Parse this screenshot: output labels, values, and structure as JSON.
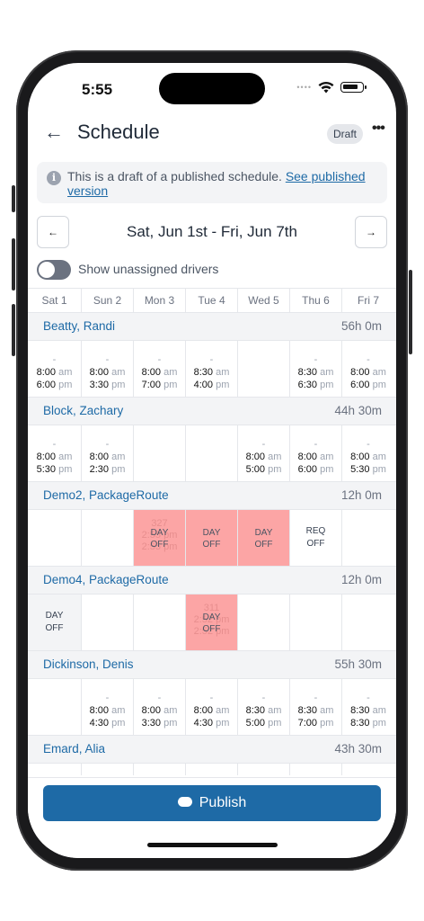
{
  "status": {
    "time": "5:55"
  },
  "header": {
    "title": "Schedule",
    "badge": "Draft",
    "more": "•••"
  },
  "notice": {
    "text": "This is a draft of a published schedule.",
    "link": "See published version"
  },
  "week": {
    "label": "Sat, Jun 1st - Fri, Jun 7th",
    "prev": "←",
    "next": "→"
  },
  "toggle": {
    "label": "Show unassigned drivers"
  },
  "days": [
    "Sat 1",
    "Sun 2",
    "Mon 3",
    "Tue 4",
    "Wed 5",
    "Thu 6",
    "Fri 7"
  ],
  "drivers": [
    {
      "name": "Beatty, Randi",
      "hours": "56h 0m"
    },
    {
      "name": "Block, Zachary",
      "hours": "44h 30m"
    },
    {
      "name": "Demo2, PackageRoute",
      "hours": "12h 0m"
    },
    {
      "name": "Demo4, PackageRoute",
      "hours": "12h 0m"
    },
    {
      "name": "Dickinson, Denis",
      "hours": "55h 30m"
    },
    {
      "name": "Emard, Alia",
      "hours": "43h 30m"
    }
  ],
  "shifts": {
    "r0c0": {
      "dash": "-",
      "start": "8:00",
      "start_ap": "am",
      "end": "6:00",
      "end_ap": "pm"
    },
    "r0c1": {
      "dash": "-",
      "start": "8:00",
      "start_ap": "am",
      "end": "3:30",
      "end_ap": "pm"
    },
    "r0c2": {
      "dash": "-",
      "start": "8:00",
      "start_ap": "am",
      "end": "7:00",
      "end_ap": "pm"
    },
    "r0c3": {
      "dash": "-",
      "start": "8:30",
      "start_ap": "am",
      "end": "4:00",
      "end_ap": "pm"
    },
    "r0c5": {
      "dash": "-",
      "start": "8:30",
      "start_ap": "am",
      "end": "6:30",
      "end_ap": "pm"
    },
    "r0c6": {
      "dash": "-",
      "start": "8:00",
      "start_ap": "am",
      "end": "6:00",
      "end_ap": "pm"
    },
    "r1c0": {
      "dash": "-",
      "start": "8:00",
      "start_ap": "am",
      "end": "5:30",
      "end_ap": "pm"
    },
    "r1c1": {
      "dash": "-",
      "start": "8:00",
      "start_ap": "am",
      "end": "2:30",
      "end_ap": "pm"
    },
    "r1c4": {
      "dash": "-",
      "start": "8:00",
      "start_ap": "am",
      "end": "5:00",
      "end_ap": "pm"
    },
    "r1c5": {
      "dash": "-",
      "start": "8:00",
      "start_ap": "am",
      "end": "6:00",
      "end_ap": "pm"
    },
    "r1c6": {
      "dash": "-",
      "start": "8:00",
      "start_ap": "am",
      "end": "5:30",
      "end_ap": "pm"
    },
    "r4c1": {
      "dash": "-",
      "start": "8:00",
      "start_ap": "am",
      "end": "4:30",
      "end_ap": "pm"
    },
    "r4c2": {
      "dash": "-",
      "start": "8:00",
      "start_ap": "am",
      "end": "3:30",
      "end_ap": "pm"
    },
    "r4c3": {
      "dash": "-",
      "start": "8:00",
      "start_ap": "am",
      "end": "4:30",
      "end_ap": "pm"
    },
    "r4c4": {
      "dash": "-",
      "start": "8:30",
      "start_ap": "am",
      "end": "5:00",
      "end_ap": "pm"
    },
    "r4c5": {
      "dash": "-",
      "start": "8:30",
      "start_ap": "am",
      "end": "7:00",
      "end_ap": "pm"
    },
    "r4c6": {
      "dash": "-",
      "start": "8:30",
      "start_ap": "am",
      "end": "8:30",
      "end_ap": "pm"
    }
  },
  "dayoff": {
    "label1": "DAY",
    "label2": "OFF",
    "req1": "REQ",
    "req2": "OFF",
    "ghost_mon_code": "327",
    "ghost_mon_t1": "2:55 pm",
    "ghost_mon_t2": "2:55 pm",
    "ghost_tue4": "311",
    "ghost_tue4_t1": "2:52 pm",
    "ghost_tue4_t2": "2:52 pm"
  },
  "footer": {
    "publish": "Publish"
  },
  "colors": {
    "accent": "#1e6aa6",
    "dayoff": "#fca5a5",
    "draft_badge": "#e5e7eb"
  }
}
